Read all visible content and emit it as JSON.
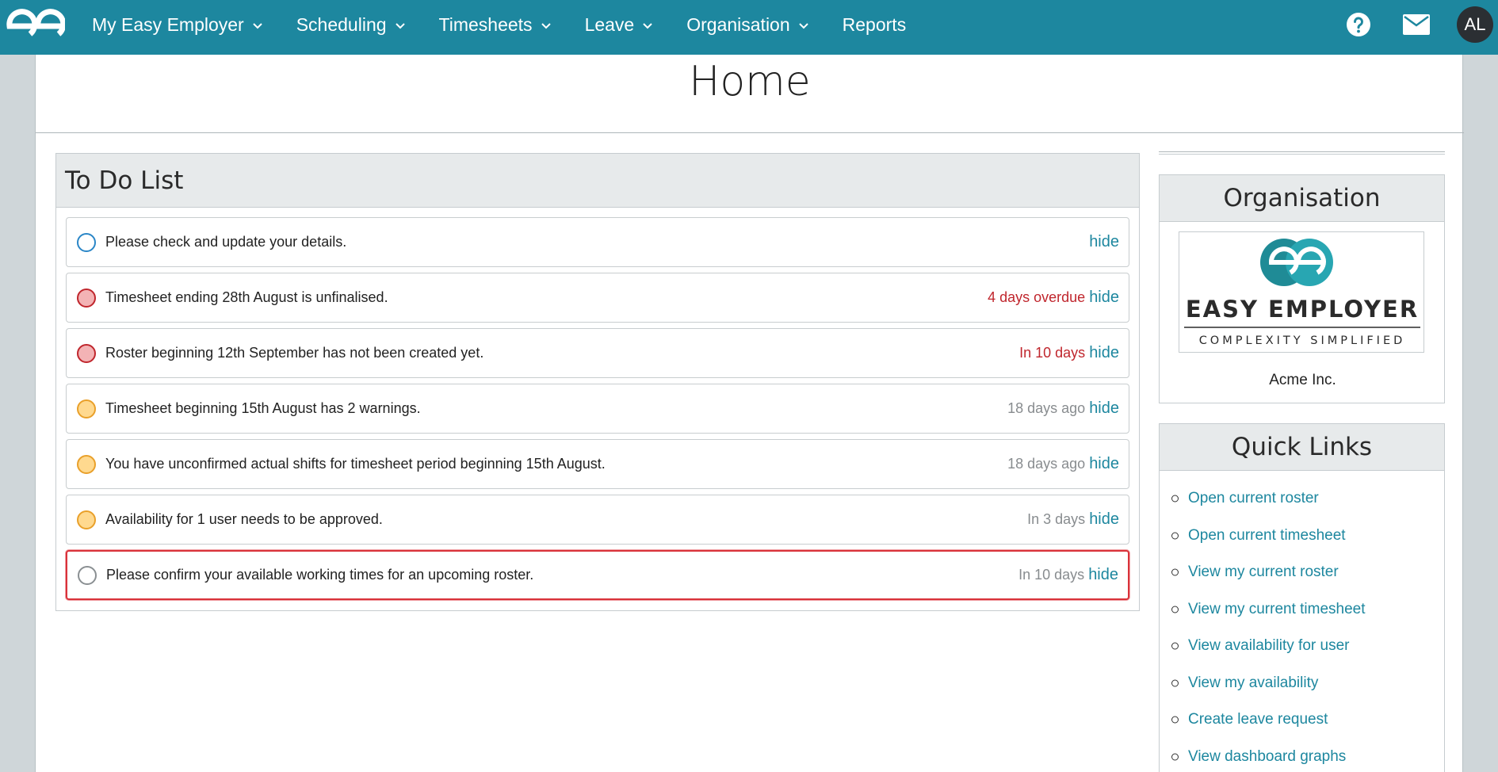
{
  "nav": {
    "items": [
      {
        "label": "My Easy Employer",
        "has_dropdown": true
      },
      {
        "label": "Scheduling",
        "has_dropdown": true
      },
      {
        "label": "Timesheets",
        "has_dropdown": true
      },
      {
        "label": "Leave",
        "has_dropdown": true
      },
      {
        "label": "Organisation",
        "has_dropdown": true
      },
      {
        "label": "Reports",
        "has_dropdown": false
      }
    ],
    "avatar_initials": "AL"
  },
  "page": {
    "title": "Home"
  },
  "todo": {
    "title": "To Do List",
    "hide_label": "hide",
    "items": [
      {
        "text": "Please check and update your details.",
        "meta": "",
        "status": "blue"
      },
      {
        "text": "Timesheet ending 28th August is unfinalised.",
        "meta": "4 days overdue",
        "status": "red"
      },
      {
        "text": "Roster beginning 12th September has not been created yet.",
        "meta": "In 10 days",
        "status": "red"
      },
      {
        "text": "Timesheet beginning 15th August has 2 warnings.",
        "meta": "18 days ago",
        "status": "orange"
      },
      {
        "text": "You have unconfirmed actual shifts for timesheet period beginning 15th August.",
        "meta": "18 days ago",
        "status": "orange"
      },
      {
        "text": "Availability for 1 user needs to be approved.",
        "meta": "In 3 days",
        "status": "orange"
      },
      {
        "text": "Please confirm your available working times for an upcoming roster.",
        "meta": "In 10 days",
        "status": "grey"
      }
    ]
  },
  "organisation": {
    "title": "Organisation",
    "logo_text": "EASY EMPLOYER",
    "logo_tagline": "COMPLEXITY SIMPLIFIED",
    "name": "Acme Inc."
  },
  "quick_links": {
    "title": "Quick Links",
    "items": [
      "Open current roster",
      "Open current timesheet",
      "View my current roster",
      "View my current timesheet",
      "View availability for user",
      "View my availability",
      "Create leave request",
      "View dashboard graphs"
    ]
  },
  "colors": {
    "nav_bg": "#1d879f",
    "link": "#1d879f",
    "overdue": "#c0262d"
  }
}
